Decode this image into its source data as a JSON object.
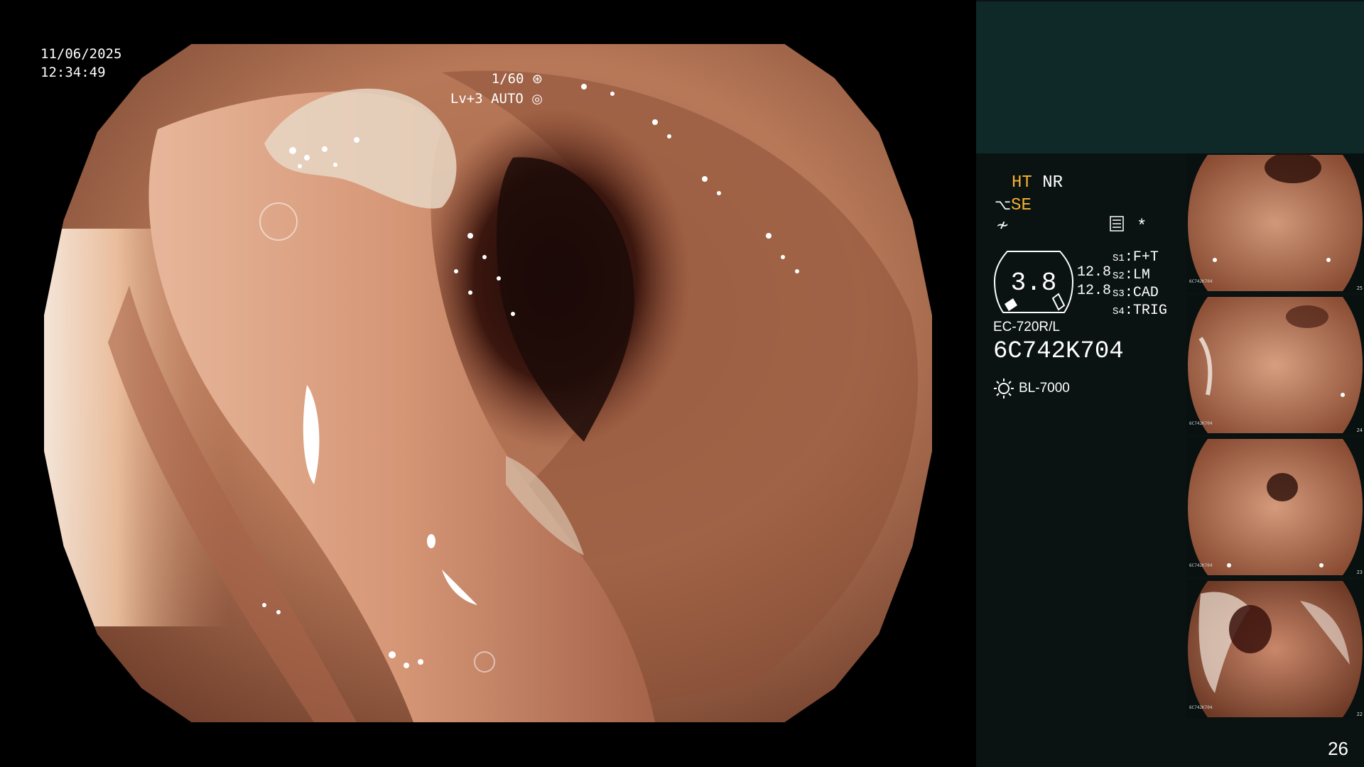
{
  "osd": {
    "date": "11/06/2025",
    "time": "12:34:49",
    "shutter": "1/60",
    "gain": "Lv+3 AUTO",
    "shutter_icon": "aperture-icon",
    "auto_icon": "iris-icon"
  },
  "panel": {
    "enhance_label": "HT",
    "enhance_value": "NR",
    "structure_label": "SE",
    "structure_icon": "structure-enhance-icon",
    "color_icon": "color-mode-icon",
    "menu_icon": "settings-menu-icon",
    "asterisk": "*",
    "gauge_value": "3.8",
    "readout_1": "12.8",
    "readout_2": "12.8",
    "switches": [
      {
        "id": "S1",
        "value": "F+T"
      },
      {
        "id": "S2",
        "value": "LM"
      },
      {
        "id": "S3",
        "value": "CAD"
      },
      {
        "id": "S4",
        "value": "TRIG"
      }
    ],
    "scope_model": "EC-720R/L",
    "scope_serial": "6C742K704",
    "lamp_icon": "light-source-icon",
    "lamp_model": "BL-7000"
  },
  "thumbnails": [
    {
      "serial": "6C742K704",
      "number": "25"
    },
    {
      "serial": "6C742K704",
      "number": "24"
    },
    {
      "serial": "6C742K704",
      "number": "23"
    },
    {
      "serial": "6C742K704",
      "number": "22"
    }
  ],
  "page_number": "26",
  "colors": {
    "accent_orange": "#f5b131",
    "panel_top": "#0f2828",
    "panel_bg": "#0a1212",
    "mucosa": "#c98a68"
  }
}
